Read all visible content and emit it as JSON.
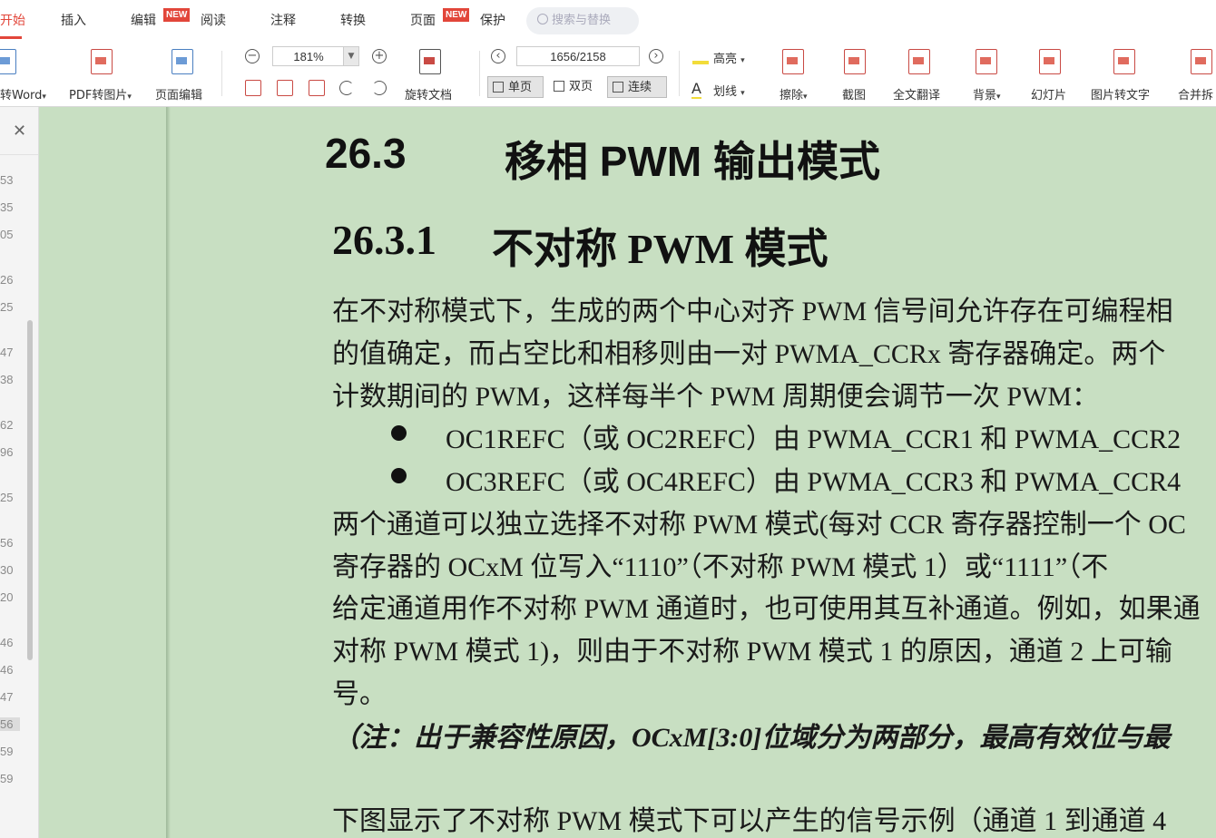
{
  "menu": {
    "kaishi": "开始",
    "charu": "插入",
    "bianji": "编辑",
    "new1": "NEW",
    "yuedu": "阅读",
    "zhushi": "注释",
    "zhuanhuan": "转换",
    "yemian": "页面",
    "new2": "NEW",
    "baohu": "保护",
    "search_placeholder": "搜索与替换"
  },
  "toolbar": {
    "to_word": "转Word",
    "pdf_to_image": "PDF转图片",
    "page_edit": "页面编辑",
    "zoom": "181%",
    "rotate_doc": "旋转文档",
    "page_number": "1656/2158",
    "single_page": "单页",
    "double_page": "双页",
    "continuous": "连续",
    "highlight": "高亮",
    "underline": "划线",
    "erase": "擦除",
    "screenshot": "截图",
    "full_translate": "全文翻译",
    "background": "背景",
    "slideshow": "幻灯片",
    "image_to_text": "图片转文字",
    "merge_split": "合并拆"
  },
  "sidebar": {
    "pages": [
      "53",
      "35",
      "05",
      "26",
      "25",
      "47",
      "38",
      "62",
      "96",
      "25",
      "56",
      "30",
      "20",
      "46",
      "46",
      "47",
      "56",
      "59",
      "59"
    ]
  },
  "doc": {
    "h2_num": "26.3",
    "h2_title": "移相 PWM 输出模式",
    "h3_num": "26.3.1",
    "h3_title": "不对称 PWM 模式",
    "p1": [
      "在不对称模式下，生成的两个中心对齐 PWM 信号间允许存在可编程相",
      "的值确定，而占空比和相移则由一对  PWMA_CCRx  寄存器确定。两个",
      "计数期间的 PWM，这样每半个 PWM 周期便会调节一次 PWM："
    ],
    "bullets": [
      "OC1REFC（或 OC2REFC）由 PWMA_CCR1 和 PWMA_CCR2",
      "OC3REFC（或 OC4REFC）由 PWMA_CCR3 和 PWMA_CCR4"
    ],
    "p2": [
      "两个通道可以独立选择不对称 PWM 模式(每对 CCR 寄存器控制一个 OC",
      "寄存器的 OCxM  位写入“1110”（不对称 PWM 模式 1）或“1111”（不",
      "给定通道用作不对称 PWM 通道时，也可使用其互补通道。例如，如果通",
      "对称 PWM 模式 1)，则由于不对称 PWM 模式 1 的原因，通道 2 上可输",
      "号。"
    ],
    "note": "（注：出于兼容性原因，OCxM[3:0]位域分为两部分，最高有效位与最",
    "p3": "下图显示了不对称 PWM 模式下可以产生的信号示例（通道 1 到通道 4"
  }
}
